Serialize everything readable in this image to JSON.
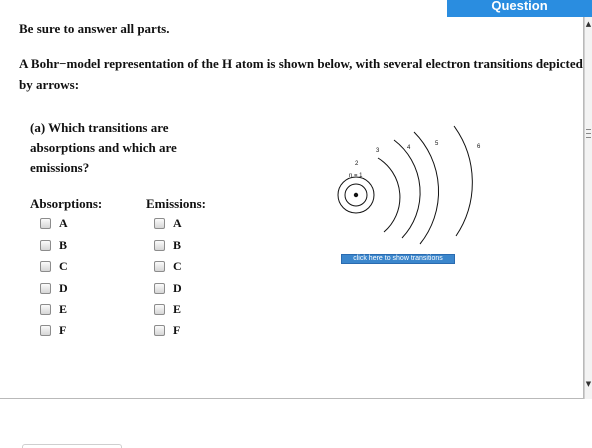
{
  "header": {
    "tab_label": "Question"
  },
  "question": {
    "instruction": "Be sure to answer all parts.",
    "prompt": "A Bohr−model representation of the H atom is shown below, with several electron transitions depicted by arrows:",
    "part_a": "(a) Which transitions are absorptions and which are emissions?"
  },
  "answers": {
    "absorptions_header": "Absorptions:",
    "emissions_header": "Emissions:",
    "absorptions": [
      "A",
      "B",
      "C",
      "D",
      "E",
      "F"
    ],
    "emissions": [
      "A",
      "B",
      "C",
      "D",
      "E",
      "F"
    ]
  },
  "diagram": {
    "level_labels": [
      "n = 1",
      "2",
      "3",
      "4",
      "5",
      "6"
    ],
    "show_transitions_label": "click here to show transitions"
  },
  "scrollbar": {
    "up_icon": "scroll-up-arrow",
    "down_icon": "scroll-down-arrow"
  }
}
